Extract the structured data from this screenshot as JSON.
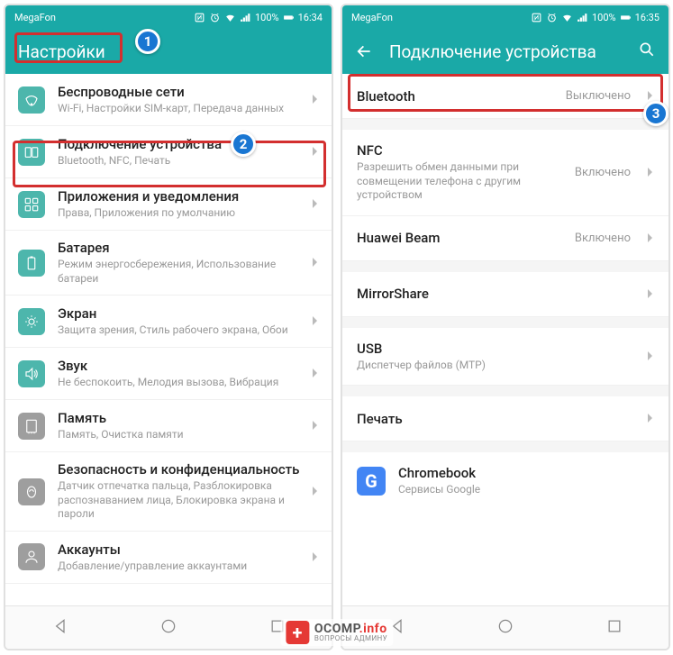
{
  "left": {
    "status": {
      "carrier": "MegaFon",
      "battery": "100%",
      "time": "16:34"
    },
    "header": {
      "title": "Настройки"
    },
    "items": [
      {
        "title": "Беспроводные сети",
        "sub": "Wi-Fi, Настройки SIM-карт, Передача данных",
        "icon": "wifi-icon",
        "color": "ic-wifi"
      },
      {
        "title": "Подключение устройства",
        "sub": "Bluetooth, NFC, Печать",
        "icon": "device-connection-icon",
        "color": "ic-conn"
      },
      {
        "title": "Приложения и уведомления",
        "sub": "Права, Приложения по умолчанию",
        "icon": "apps-icon",
        "color": "ic-apps"
      },
      {
        "title": "Батарея",
        "sub": "Режим энергосбережения, Использование батареи",
        "icon": "battery-icon",
        "color": "ic-batt"
      },
      {
        "title": "Экран",
        "sub": "Защита зрения, Стиль рабочего экрана, Обои",
        "icon": "screen-icon",
        "color": "ic-screen"
      },
      {
        "title": "Звук",
        "sub": "Не беспокоить, Мелодия вызова, Вибрация",
        "icon": "sound-icon",
        "color": "ic-sound"
      },
      {
        "title": "Память",
        "sub": "Память, Очистка памяти",
        "icon": "memory-icon",
        "color": "ic-mem"
      },
      {
        "title": "Безопасность и конфиденциальность",
        "sub": "Датчик отпечатка пальца, Разблокировка распознаванием лица, Блокировка экрана и пароли",
        "icon": "security-icon",
        "color": "ic-sec"
      },
      {
        "title": "Аккаунты",
        "sub": "Добавление/управление аккаунтами",
        "icon": "accounts-icon",
        "color": "ic-acc"
      }
    ]
  },
  "right": {
    "status": {
      "carrier": "MegaFon",
      "battery": "100%",
      "time": "16:35"
    },
    "header": {
      "title": "Подключение устройства"
    },
    "items": [
      {
        "title": "Bluetooth",
        "value": "Выключено"
      },
      {
        "title": "NFC",
        "sub": "Разрешить обмен данными при совмещении телефона с другим устройством",
        "value": "Включено"
      },
      {
        "title": "Huawei Beam",
        "value": "Включено"
      },
      {
        "title": "MirrorShare"
      },
      {
        "title": "USB",
        "sub": "Диспетчер файлов (MTP)"
      },
      {
        "title": "Печать"
      }
    ],
    "chromebook": {
      "title": "Chromebook",
      "sub": "Сервисы Google"
    }
  },
  "watermark": {
    "top": "OCOMP",
    "info": ".info",
    "bottom": "ВОПРОСЫ АДМИНУ"
  },
  "badges": {
    "b1": "1",
    "b2": "2",
    "b3": "3"
  }
}
